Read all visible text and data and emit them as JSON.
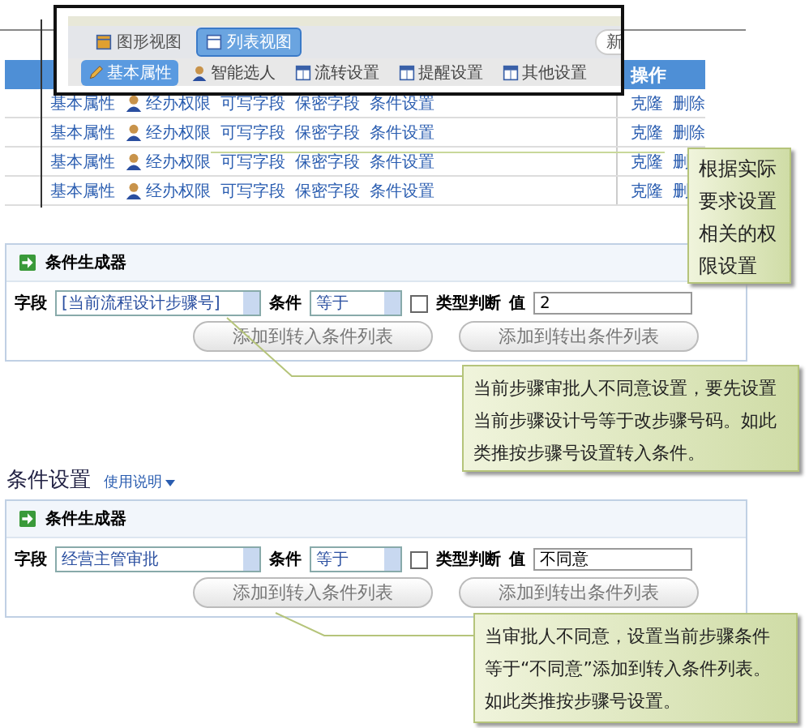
{
  "view_window": {
    "view_tabs": [
      {
        "label": "图形视图",
        "selected": false
      },
      {
        "label": "列表视图",
        "selected": true
      }
    ],
    "partial_button": "新",
    "tabs": [
      {
        "label": "基本属性",
        "selected": true
      },
      {
        "label": "智能选人",
        "selected": false
      },
      {
        "label": "流转设置",
        "selected": false
      },
      {
        "label": "提醒设置",
        "selected": false
      },
      {
        "label": "其他设置",
        "selected": false
      }
    ]
  },
  "permissions_table": {
    "action_header": "操作",
    "rows": [
      {
        "links": [
          "基本属性",
          "经办权限",
          "可写字段",
          "保密字段",
          "条件设置"
        ],
        "actions": [
          "克隆",
          "删除"
        ]
      },
      {
        "links": [
          "基本属性",
          "经办权限",
          "可写字段",
          "保密字段",
          "条件设置"
        ],
        "actions": [
          "克隆",
          "删除"
        ]
      },
      {
        "links": [
          "基本属性",
          "经办权限",
          "可写字段",
          "保密字段",
          "条件设置"
        ],
        "actions": [
          "克隆",
          "删"
        ]
      },
      {
        "links": [
          "基本属性",
          "经办权限",
          "可写字段",
          "保密字段",
          "条件设置"
        ],
        "actions": [
          "克隆",
          "删"
        ]
      }
    ]
  },
  "generator_top": {
    "title": "条件生成器",
    "field_label": "字段",
    "field_value": "[当前流程设计步骤号]",
    "condition_label": "条件",
    "condition_value": "等于",
    "type_check": {
      "label": "类型判断",
      "checked": false
    },
    "value_label": "值",
    "value": "2",
    "buttons": [
      "添加到转入条件列表",
      "添加到转出条件列表"
    ]
  },
  "condition_settings": {
    "title": "条件设置",
    "help_link": "使用说明",
    "generator": {
      "title": "条件生成器",
      "field_label": "字段",
      "field_value": "经营主管审批",
      "condition_label": "条件",
      "condition_value": "等于",
      "type_check": {
        "label": "类型判断",
        "checked": false
      },
      "value_label": "值",
      "value": "不同意",
      "buttons": [
        "添加到转入条件列表",
        "添加到转出条件列表"
      ]
    }
  },
  "callouts": [
    "根据实际要求设置相关的权限设置",
    "当前步骤审批人不同意设置，要先设置当前步骤设计号等于改步骤号码。如此类推按步骤号设置转入条件。",
    "当审批人不同意，设置当前步骤条件等于“不同意”添加到转入条件列表。如此类推按步骤号设置。"
  ]
}
